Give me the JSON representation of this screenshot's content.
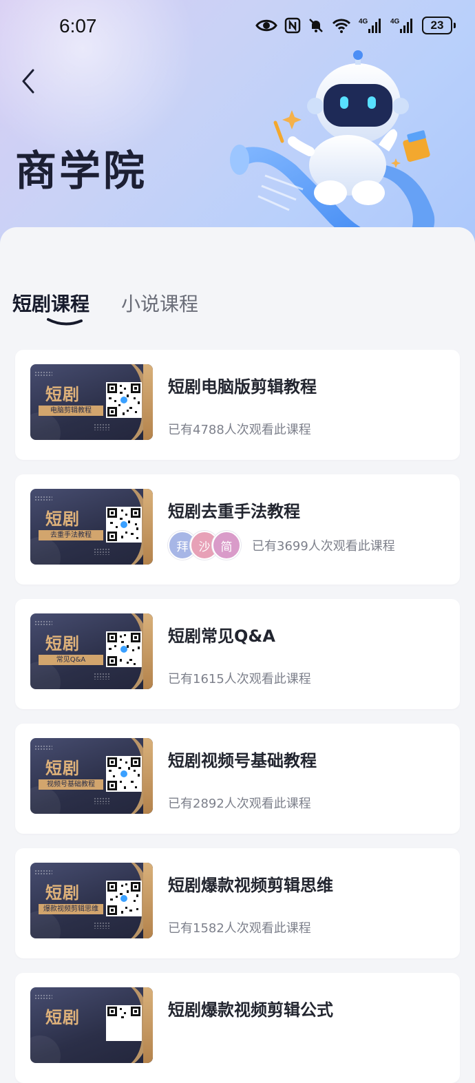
{
  "status_bar": {
    "time": "6:07",
    "battery": "23"
  },
  "header": {
    "title": "商学院"
  },
  "tabs": [
    {
      "label": "短剧课程",
      "active": true
    },
    {
      "label": "小说课程",
      "active": false
    }
  ],
  "courses": [
    {
      "title": "短剧电脑版剪辑教程",
      "thumb_big": "短剧",
      "thumb_sub": "电脑剪辑教程",
      "views": "已有4788人次观看此课程"
    },
    {
      "title": "短剧去重手法教程",
      "thumb_big": "短剧",
      "thumb_sub": "去重手法教程",
      "views": "已有3699人次观看此课程",
      "avatars": [
        "拜",
        "沙",
        "简"
      ]
    },
    {
      "title": "短剧常见Q&A",
      "thumb_big": "短剧",
      "thumb_sub": "常见Q&A",
      "views": "已有1615人次观看此课程"
    },
    {
      "title": "短剧视频号基础教程",
      "thumb_big": "短剧",
      "thumb_sub": "视频号基础教程",
      "views": "已有2892人次观看此课程"
    },
    {
      "title": "短剧爆款视频剪辑思维",
      "thumb_big": "短剧",
      "thumb_sub": "爆款视频剪辑思维",
      "views": "已有1582人次观看此课程"
    },
    {
      "title": "短剧爆款视频剪辑公式",
      "thumb_big": "短剧",
      "thumb_sub": "",
      "views": ""
    }
  ],
  "colors": {
    "accent_gold": "#dfb27a",
    "avatar_1": "#a7b6e6",
    "avatar_2": "#e7a1b7",
    "avatar_3": "#d99bc9"
  }
}
